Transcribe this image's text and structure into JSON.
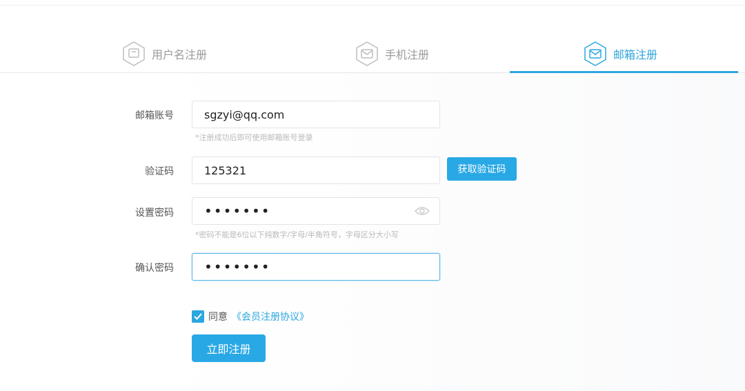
{
  "tabs": [
    {
      "label": "用户名注册",
      "icon": "user-card-icon",
      "active": false
    },
    {
      "label": "手机注册",
      "icon": "envelope-icon",
      "active": false
    },
    {
      "label": "邮箱注册",
      "icon": "envelope-icon",
      "active": true
    }
  ],
  "form": {
    "email": {
      "label": "邮箱账号",
      "value": "sgzyi@qq.com",
      "hint": "*注册成功后即可使用邮箱账号登录"
    },
    "code": {
      "label": "验证码",
      "value": "125321",
      "button": "获取验证码"
    },
    "password": {
      "label": "设置密码",
      "value": "1234567",
      "hint": "*密码不能是6位以下纯数字/字母/半角符号，字母区分大小写"
    },
    "confirm": {
      "label": "确认密码",
      "value": "1234567"
    },
    "agree": {
      "checked": true,
      "text": "同意",
      "link": "《会员注册协议》"
    },
    "submit": "立即注册"
  },
  "colors": {
    "accent": "#2aa6e0",
    "inactive": "#9a9a9a"
  }
}
